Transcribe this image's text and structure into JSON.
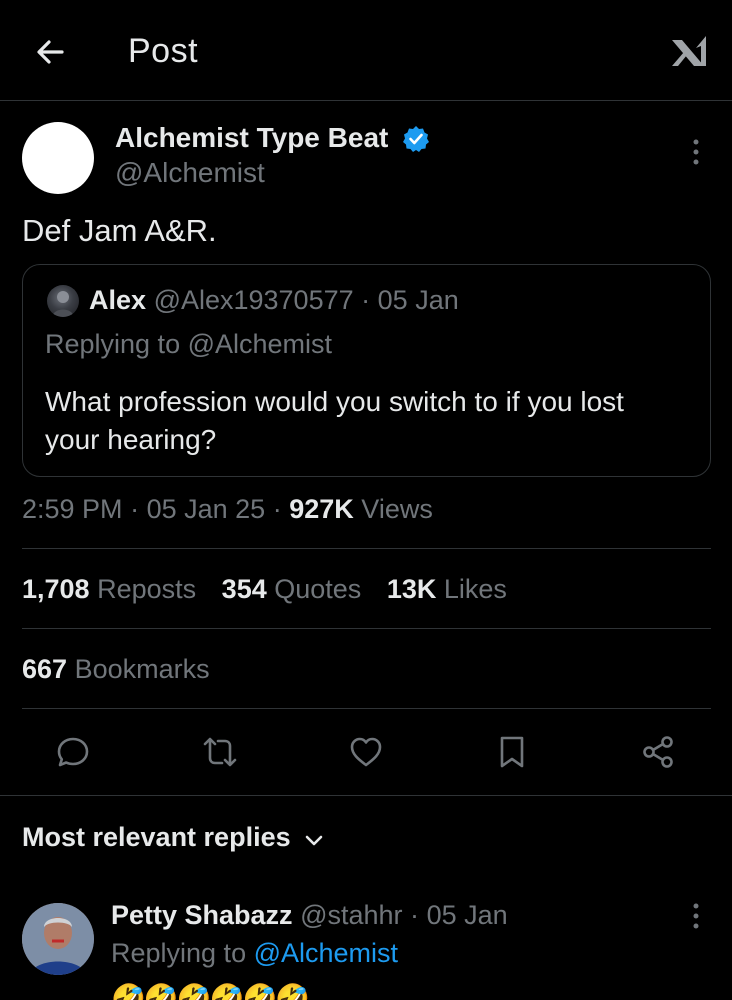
{
  "header": {
    "title": "Post",
    "back_icon": "arrow-left-icon",
    "logo_icon": "x-logo-icon"
  },
  "post": {
    "author_name": "Alchemist Type Beat",
    "author_handle": "@Alchemist",
    "verified": true,
    "text": "Def Jam A&R.",
    "quoted": {
      "name": "Alex",
      "handle": "@Alex19370577",
      "separator": "·",
      "date": "05 Jan",
      "replying_to": "Replying to @Alchemist",
      "text": "What profession would you switch to if you lost your hearing?"
    },
    "time": "2:59 PM",
    "date": "05 Jan 25",
    "separator": "·",
    "views_count": "927K",
    "views_label": "Views"
  },
  "stats": {
    "reposts_count": "1,708",
    "reposts_label": "Reposts",
    "quotes_count": "354",
    "quotes_label": "Quotes",
    "likes_count": "13K",
    "likes_label": "Likes",
    "bookmarks_count": "667",
    "bookmarks_label": "Bookmarks"
  },
  "actions": [
    "reply-icon",
    "repost-icon",
    "like-icon",
    "bookmark-icon",
    "share-icon"
  ],
  "replies": {
    "sort_label": "Most relevant replies",
    "items": [
      {
        "name": "Petty Shabazz",
        "handle": "@stahhr",
        "separator": "·",
        "date": "05 Jan",
        "replying_prefix": "Replying to",
        "replying_to": "@Alchemist",
        "text": "🤣🤣🤣🤣🤣🤣"
      }
    ]
  },
  "colors": {
    "background": "#000000",
    "text": "#e7e9ea",
    "muted": "#71767b",
    "accent": "#1d9bf0",
    "divider": "#2f3336"
  }
}
